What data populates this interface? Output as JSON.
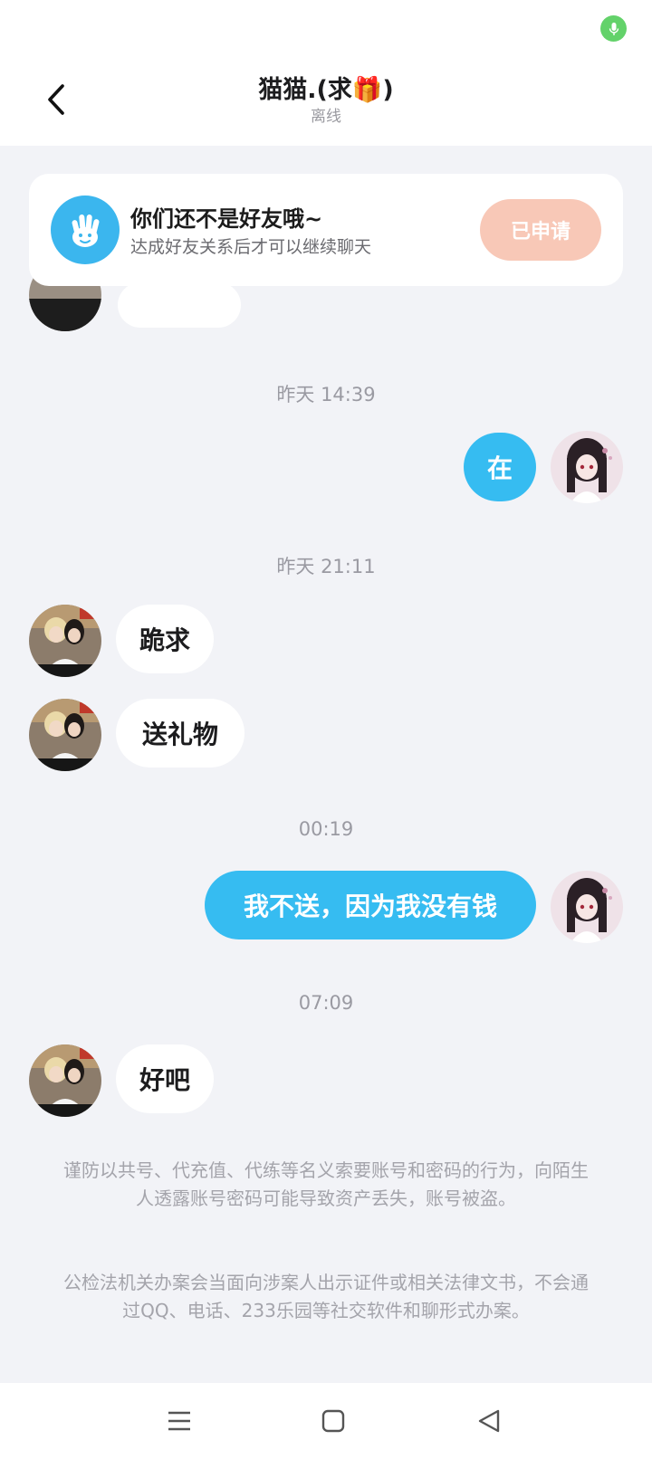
{
  "header": {
    "title": "猫猫.(求🎁)",
    "status": "离线"
  },
  "friend_card": {
    "title": "你们还不是好友哦~",
    "subtitle": "达成好友关系后才可以继续聊天",
    "button_label": "已申请"
  },
  "messages": [
    {
      "time": "昨天 14:39"
    },
    {
      "from": "me",
      "text": "在"
    },
    {
      "time": "昨天 21:11"
    },
    {
      "from": "contact",
      "text": "跪求"
    },
    {
      "from": "contact",
      "text": "送礼物"
    },
    {
      "time": "00:19"
    },
    {
      "from": "me",
      "text": "我不送，因为我没有钱"
    },
    {
      "time": "07:09"
    },
    {
      "from": "contact",
      "text": "好吧"
    }
  ],
  "notice": {
    "line1": "谨防以共号、代充值、代练等名义索要账号和密码的行为，向陌生人透露账号密码可能导致资产丢失，账号被盗。",
    "line2": "公检法机关办案会当面向涉案人出示证件或相关法律文书，不会通过QQ、电话、233乐园等社交软件和聊形式办案。"
  },
  "icons": {
    "status": "mic-icon",
    "back": "back-arrow-icon",
    "card": "hand-wave-icon",
    "nav": [
      "menu-icon",
      "home-icon",
      "back-triangle-icon"
    ]
  },
  "colors": {
    "background": "#f2f3f7",
    "outgoing_bubble": "#36bcf1",
    "applied_button": "#f8c8b7",
    "hand_avatar": "#3bb6ee",
    "mic_dot": "#63d26a"
  }
}
